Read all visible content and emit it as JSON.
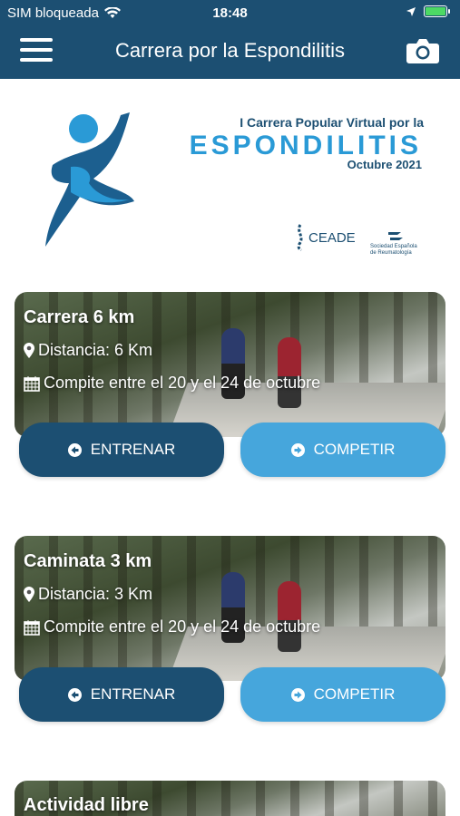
{
  "status": {
    "carrier": "SIM bloqueada",
    "time": "18:48"
  },
  "header": {
    "title": "Carrera por la Espondilitis"
  },
  "hero": {
    "line1": "I Carrera Popular Virtual por la",
    "line2": "ESPONDILITIS",
    "line3": "Octubre 2021",
    "ceade": "CEADE",
    "ser": "Sociedad Española de Reumatología"
  },
  "cards": [
    {
      "title": "Carrera 6 km",
      "distance": "Distancia: 6 Km",
      "dates": "Compite entre el 20 y el 24 de octubre",
      "train": "ENTRENAR",
      "compete": "COMPETIR"
    },
    {
      "title": "Caminata 3 km",
      "distance": "Distancia: 3 Km",
      "dates": "Compite entre el 20 y el 24 de octubre",
      "train": "ENTRENAR",
      "compete": "COMPETIR"
    },
    {
      "title": "Actividad libre"
    }
  ],
  "colors": {
    "primary": "#1c4f72",
    "accent": "#46a6dc",
    "battery": "#4cd964"
  },
  "icons": {
    "menu": "hamburger-icon",
    "camera": "camera-icon",
    "distance": "map-pin-icon",
    "dates": "calendar-icon",
    "train": "arrow-left-circle-icon",
    "compete": "arrow-right-circle-icon"
  }
}
